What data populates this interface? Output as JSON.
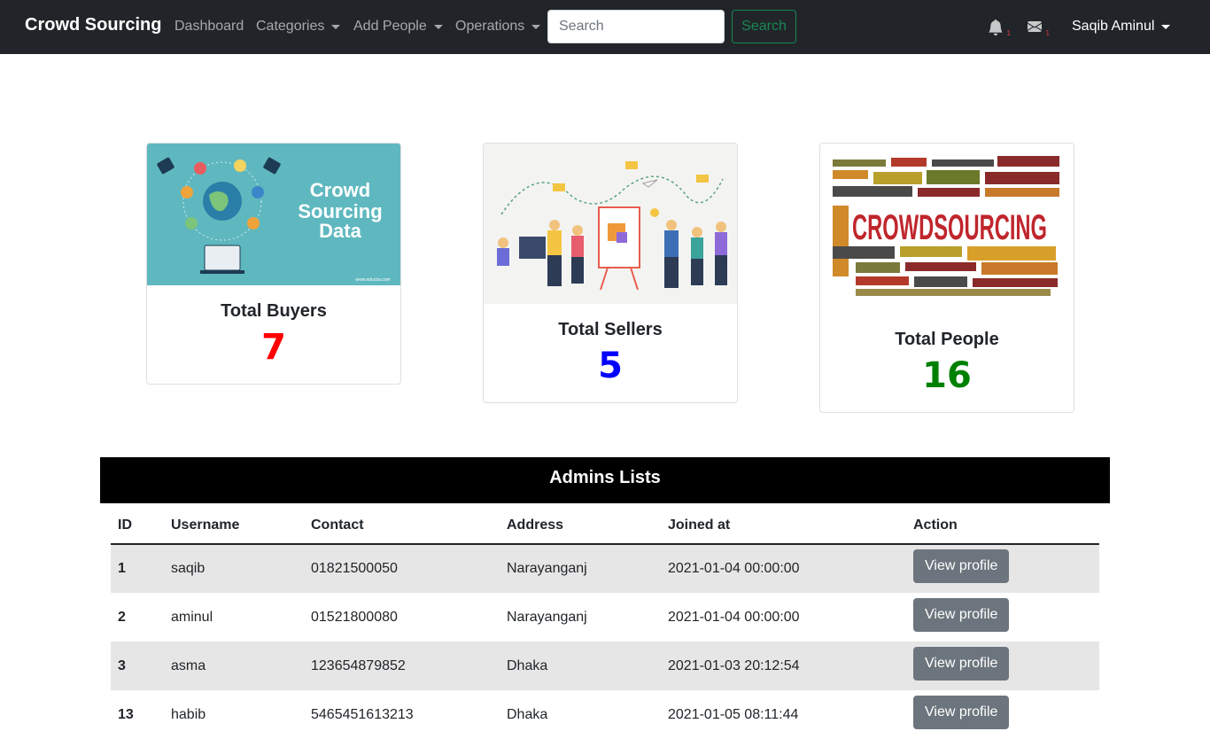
{
  "navbar": {
    "brand": "Crowd Sourcing",
    "links": [
      {
        "label": "Dashboard",
        "dropdown": false
      },
      {
        "label": "Categories",
        "dropdown": true
      },
      {
        "label": "Add People",
        "dropdown": true
      },
      {
        "label": "Operations",
        "dropdown": true
      }
    ],
    "search_placeholder": "Search",
    "search_button": "Search",
    "notification_count": "1",
    "message_count": "1",
    "user_name": "Saqib Aminul"
  },
  "cards": [
    {
      "title": "Total Buyers",
      "value": "7",
      "color": "#ff0000",
      "image_text": [
        "Crowd",
        "Sourcing",
        "Data"
      ],
      "image_caption": "www.educba.com"
    },
    {
      "title": "Total Sellers",
      "value": "5",
      "color": "#0000ff"
    },
    {
      "title": "Total People",
      "value": "16",
      "color": "#008000",
      "image_text": "CROWDSOURCING"
    }
  ],
  "admins": {
    "title": "Admins Lists",
    "columns": [
      "ID",
      "Username",
      "Contact",
      "Address",
      "Joined at",
      "Action"
    ],
    "rows": [
      {
        "id": "1",
        "username": "saqib",
        "contact": "01821500050",
        "address": "Narayanganj",
        "joined": "2021-01-04 00:00:00",
        "action": "View profile"
      },
      {
        "id": "2",
        "username": "aminul",
        "contact": "01521800080",
        "address": "Narayanganj",
        "joined": "2021-01-04 00:00:00",
        "action": "View profile"
      },
      {
        "id": "3",
        "username": "asma",
        "contact": "123654879852",
        "address": "Dhaka",
        "joined": "2021-01-03 20:12:54",
        "action": "View profile"
      },
      {
        "id": "13",
        "username": "habib",
        "contact": "5465451613213",
        "address": "Dhaka",
        "joined": "2021-01-05 08:11:44",
        "action": "View profile"
      }
    ]
  }
}
